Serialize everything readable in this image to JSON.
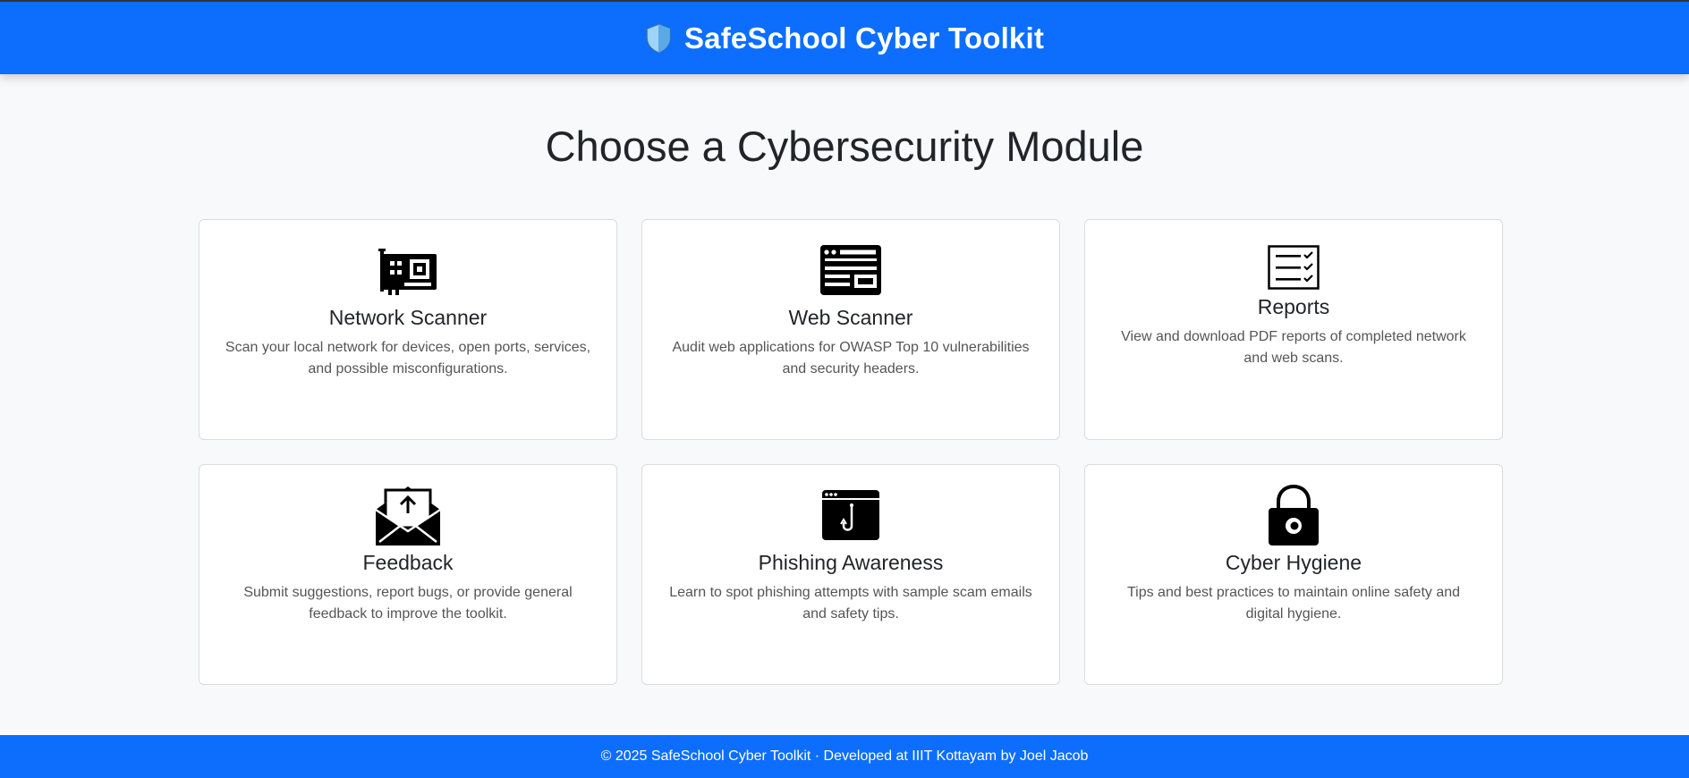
{
  "header": {
    "title": "SafeSchool Cyber Toolkit",
    "logo_icon": "shield-icon",
    "background_color": "#0d6efd"
  },
  "main": {
    "heading": "Choose a Cybersecurity Module"
  },
  "modules": [
    {
      "icon": "network-card-icon",
      "title": "Network Scanner",
      "description": "Scan your local network for devices, open ports, services, and possible misconfigurations."
    },
    {
      "icon": "browser-window-icon",
      "title": "Web Scanner",
      "description": "Audit web applications for OWASP Top 10 vulnerabilities and security headers."
    },
    {
      "icon": "checklist-icon",
      "title": "Reports",
      "description": "View and download PDF reports of completed network and web scans."
    },
    {
      "icon": "envelope-upload-icon",
      "title": "Feedback",
      "description": "Submit suggestions, report bugs, or provide general feedback to improve the toolkit."
    },
    {
      "icon": "phishing-hook-icon",
      "title": "Phishing Awareness",
      "description": "Learn to spot phishing attempts with sample scam emails and safety tips."
    },
    {
      "icon": "padlock-icon",
      "title": "Cyber Hygiene",
      "description": "Tips and best practices to maintain online safety and digital hygiene."
    }
  ],
  "footer": {
    "text": "© 2025 SafeSchool Cyber Toolkit · Developed at IIIT Kottayam by Joel Jacob"
  }
}
